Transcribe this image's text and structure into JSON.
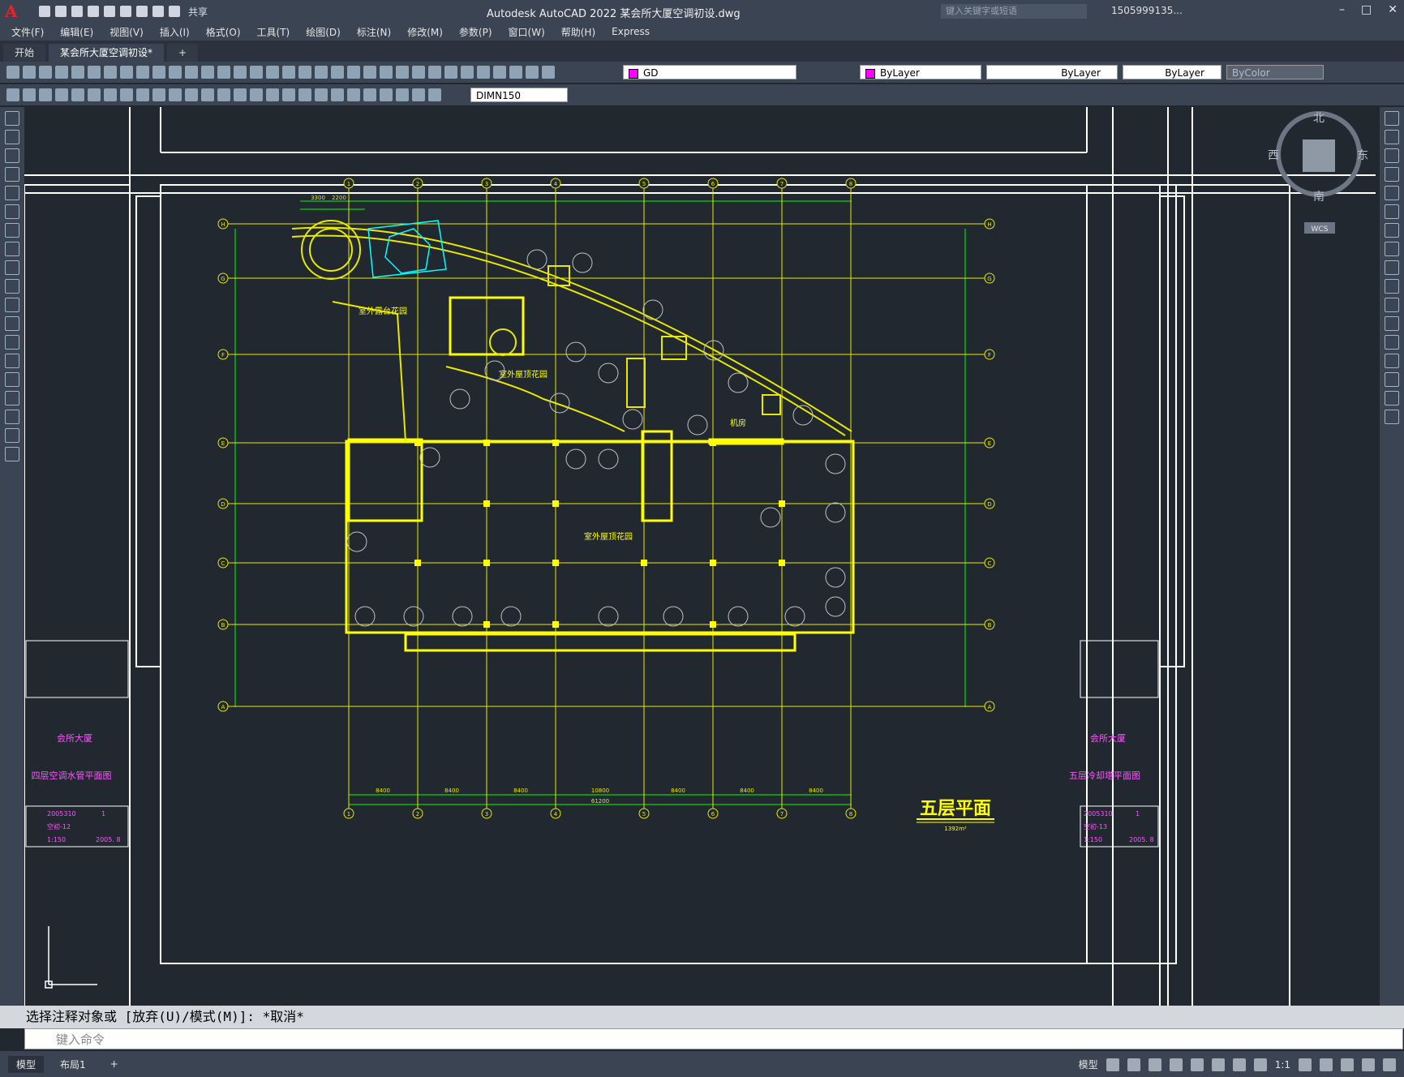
{
  "app": {
    "title": "Autodesk AutoCAD 2022    某会所大厦空调初设.dwg",
    "share": "共享",
    "search_placeholder": "键入关键字或短语",
    "user": "1505999135..."
  },
  "menus": [
    "文件(F)",
    "编辑(E)",
    "视图(V)",
    "插入(I)",
    "格式(O)",
    "工具(T)",
    "绘图(D)",
    "标注(N)",
    "修改(M)",
    "参数(P)",
    "窗口(W)",
    "帮助(H)",
    "Express"
  ],
  "tabs": [
    {
      "label": "开始",
      "active": false
    },
    {
      "label": "某会所大厦空调初设*",
      "active": true
    }
  ],
  "properties": {
    "layer": "GD",
    "color": "ByLayer",
    "linetype": "ByLayer",
    "lineweight": "ByLayer",
    "plotstyle": "ByColor",
    "dimstyle": "DIMN150",
    "layer_color": "#ff00ff"
  },
  "drawing": {
    "main_title": "五层平面",
    "subtitle": "1392m²",
    "labels": {
      "roof_garden_1": "室外露台花园",
      "roof_garden_2": "室外屋顶花园",
      "roof_garden_3": "室外屋顶花园",
      "machine_room": "机房"
    },
    "left_panel": {
      "project": "会所大厦",
      "sheet": "四层空调水管平面图",
      "date": "2005310",
      "code": "空初-12",
      "scale": "1:150",
      "year": "2005. 8",
      "no": "1"
    },
    "right_panel": {
      "project": "会所大厦",
      "sheet": "五层冷却塔平面图",
      "date": "2005310",
      "code": "空初-13",
      "scale": "1:150",
      "year": "2005. 8",
      "no": "1"
    },
    "compass": {
      "north": "北",
      "south": "南",
      "east": "东",
      "west": "西",
      "wcs": "WCS"
    },
    "axis_numbers": [
      "1",
      "2",
      "3",
      "4",
      "5",
      "6",
      "7",
      "8"
    ],
    "axis_letters": [
      "H",
      "G",
      "F",
      "E",
      "D",
      "C",
      "B",
      "A"
    ],
    "dims_bottom": [
      "8400",
      "8400",
      "8400",
      "10800",
      "8400",
      "8400",
      "8400"
    ],
    "dim_total": "61200",
    "dims_top_extra": [
      "3300",
      "2200"
    ]
  },
  "command": {
    "history": "选择注释对象或 [放弃(U)/模式(M)]: *取消*",
    "placeholder": "键入命令"
  },
  "status": {
    "layout_tabs": [
      "模型",
      "布局1"
    ],
    "model_button": "模型",
    "scale": "1:1"
  }
}
